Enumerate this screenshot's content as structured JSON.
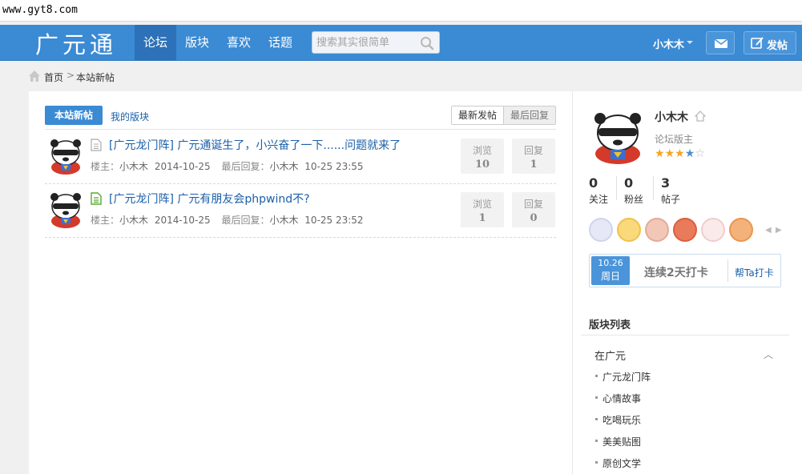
{
  "browser": {
    "url": "www.gyt8.com"
  },
  "header": {
    "logo": "广元通",
    "nav": [
      {
        "label": "论坛",
        "active": true
      },
      {
        "label": "版块",
        "active": false
      },
      {
        "label": "喜欢",
        "active": false
      },
      {
        "label": "话题",
        "active": false
      }
    ],
    "search_placeholder": "搜索其实很简单",
    "username": "小木木",
    "post_label": "发帖",
    "accent": "#3a8ad4"
  },
  "breadcrumb": {
    "home": "首页",
    "current": "本站新帖"
  },
  "tabs": {
    "new_posts": "本站新帖",
    "my_boards": "我的版块"
  },
  "sort": {
    "latest_post": "最新发帖",
    "latest_reply": "最后回复"
  },
  "threads": [
    {
      "title": "[广元龙门阵] 广元通诞生了，小兴奋了一下......问题就来了",
      "author_label": "楼主：",
      "author": "小木木",
      "date": "2014-10-25",
      "last_reply_label": "最后回复：",
      "last_reply_user": "小木木",
      "last_reply_time": "10-25 23:55",
      "views_label": "浏览",
      "views": "10",
      "replies_label": "回复",
      "replies": "1",
      "icon": "document-icon"
    },
    {
      "title": "[广元龙门阵] 广元有朋友会phpwind不?",
      "author_label": "楼主：",
      "author": "小木木",
      "date": "2014-10-25",
      "last_reply_label": "最后回复：",
      "last_reply_user": "小木木",
      "last_reply_time": "10-25 23:52",
      "views_label": "浏览",
      "views": "1",
      "replies_label": "回复",
      "replies": "0",
      "icon": "document-green-icon"
    }
  ],
  "profile": {
    "name": "小木木",
    "role": "论坛版主",
    "rating": 3.5,
    "stats": [
      {
        "value": "0",
        "label": "关注"
      },
      {
        "value": "0",
        "label": "粉丝"
      },
      {
        "value": "3",
        "label": "帖子"
      }
    ]
  },
  "checkin": {
    "date": "10.26",
    "weekday": "周日",
    "streak": "连续2天打卡",
    "help": "帮Ta打卡"
  },
  "board_list": {
    "title": "版块列表",
    "category": "在广元",
    "items": [
      "广元龙门阵",
      "心情故事",
      "吃喝玩乐",
      "美美贴图",
      "原创文学"
    ]
  }
}
